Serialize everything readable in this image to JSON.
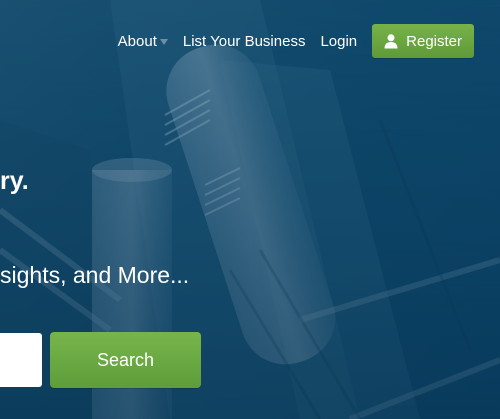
{
  "nav": {
    "about_label": "About",
    "list_business_label": "List Your Business",
    "login_label": "Login",
    "register_label": "Register",
    "caret_icon": "chevron-down-icon",
    "user_icon": "user-icon"
  },
  "hero": {
    "headline_tail": "ry.",
    "subheadline_tail": "sights, and More..."
  },
  "search": {
    "input_value": "",
    "button_label": "Search"
  },
  "colors": {
    "background": "#0f4b6f",
    "accent_green": "#6aa842",
    "text": "#ffffff"
  }
}
